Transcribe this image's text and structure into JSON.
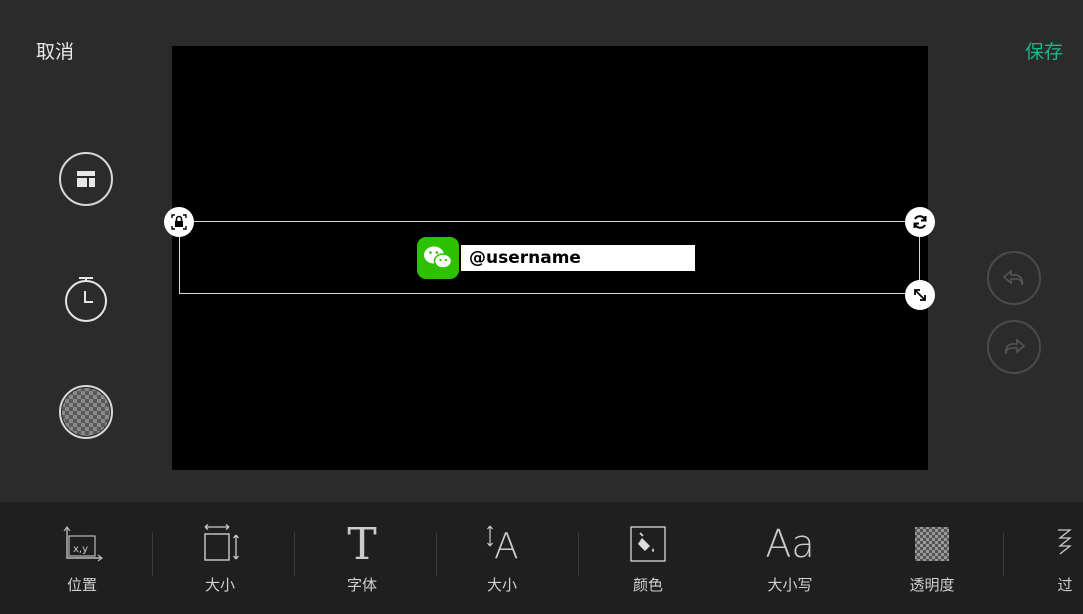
{
  "header": {
    "cancel": "取消",
    "save": "保存",
    "save_color": "#1fb48a"
  },
  "overlay": {
    "username": "@username",
    "icon": "wechat-icon"
  },
  "side_tools": [
    "layout-icon",
    "timer-icon",
    "transparency-icon"
  ],
  "history": [
    "undo-icon",
    "redo-icon"
  ],
  "toolbar": {
    "items": [
      {
        "label": "位置",
        "icon": "position-icon",
        "glyph": "x,y"
      },
      {
        "label": "大小",
        "icon": "resize-icon"
      },
      {
        "label": "字体",
        "icon": "font-icon",
        "glyph": "T"
      },
      {
        "label": "大小",
        "icon": "font-size-icon",
        "glyph": "A"
      },
      {
        "label": "颜色",
        "icon": "fill-color-icon"
      },
      {
        "label": "大小写",
        "icon": "case-icon",
        "glyph": "Aa"
      },
      {
        "label": "透明度",
        "icon": "opacity-icon"
      },
      {
        "label": "过",
        "icon": "transition-icon"
      }
    ]
  }
}
